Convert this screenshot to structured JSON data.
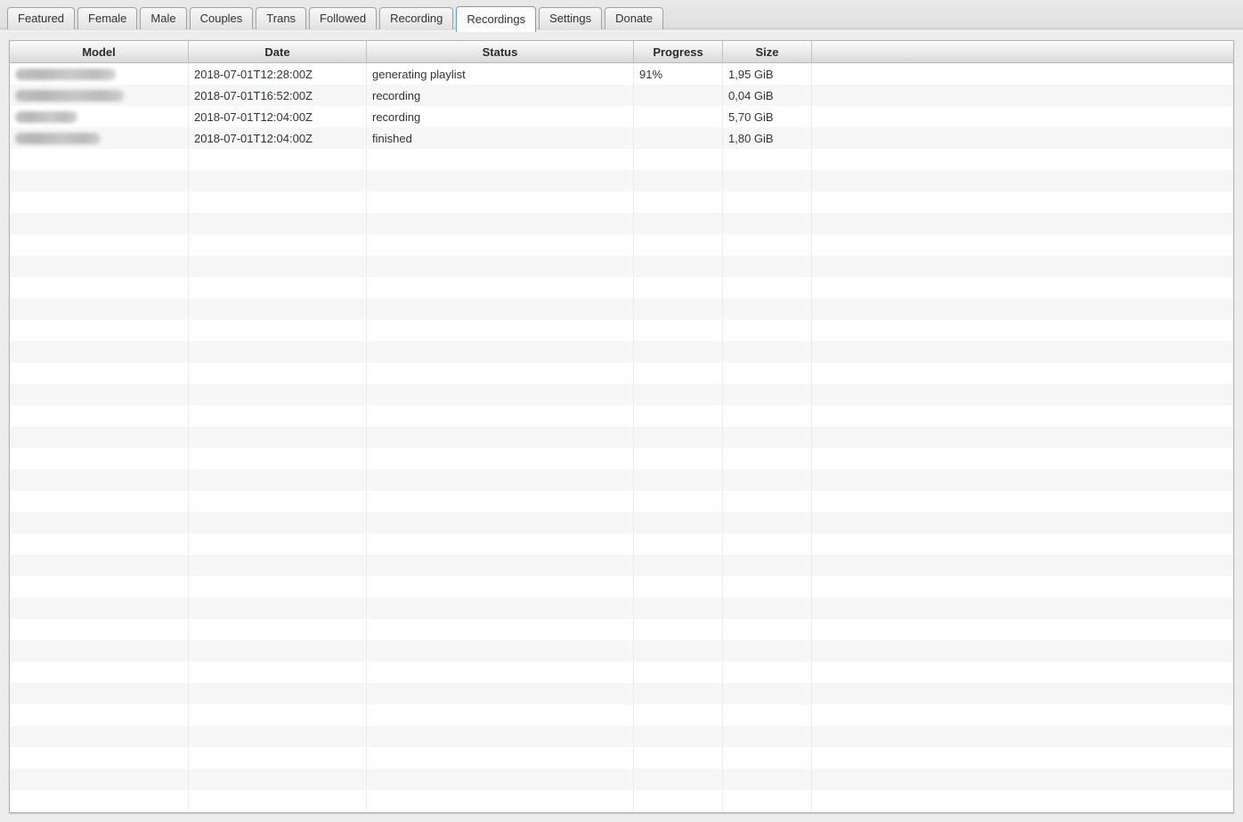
{
  "tab_bar": {
    "tabs": [
      {
        "label": "Featured",
        "active": false
      },
      {
        "label": "Female",
        "active": false
      },
      {
        "label": "Male",
        "active": false
      },
      {
        "label": "Couples",
        "active": false
      },
      {
        "label": "Trans",
        "active": false
      },
      {
        "label": "Followed",
        "active": false
      },
      {
        "label": "Recording",
        "active": false
      },
      {
        "label": "Recordings",
        "active": true
      },
      {
        "label": "Settings",
        "active": false
      },
      {
        "label": "Donate",
        "active": false
      }
    ]
  },
  "recordings_table": {
    "columns": [
      {
        "label": "Model"
      },
      {
        "label": "Date"
      },
      {
        "label": "Status"
      },
      {
        "label": "Progress"
      },
      {
        "label": "Size"
      },
      {
        "label": ""
      }
    ],
    "rows": [
      {
        "model_redacted": true,
        "date": "2018-07-01T12:28:00Z",
        "status": "generating playlist",
        "progress": "91%",
        "size": "1,95 GiB"
      },
      {
        "model_redacted": true,
        "date": "2018-07-01T16:52:00Z",
        "status": "recording",
        "progress": "",
        "size": "0,04 GiB"
      },
      {
        "model_redacted": true,
        "date": "2018-07-01T12:04:00Z",
        "status": "recording",
        "progress": "",
        "size": "5,70 GiB"
      },
      {
        "model_redacted": true,
        "date": "2018-07-01T12:04:00Z",
        "status": "finished",
        "progress": "",
        "size": "1,80 GiB"
      }
    ],
    "empty_row_count": 31
  },
  "colors": {
    "active_tab_border": "#57a7d9",
    "row_stripe": "#f6f6f6",
    "header_text": "#2b2b2b"
  }
}
